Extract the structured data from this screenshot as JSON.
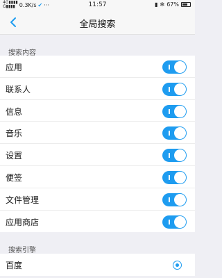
{
  "status_bar": {
    "network": "4G",
    "speed": "0.3K/s",
    "time": "11:57",
    "battery": "67%",
    "more": "···"
  },
  "header": {
    "title": "全局搜索",
    "back_icon": "chevron-left-icon"
  },
  "search_content": {
    "section_title": "搜索内容",
    "items": [
      {
        "label": "应用",
        "enabled": true
      },
      {
        "label": "联系人",
        "enabled": true
      },
      {
        "label": "信息",
        "enabled": true
      },
      {
        "label": "音乐",
        "enabled": true
      },
      {
        "label": "设置",
        "enabled": true
      },
      {
        "label": "便签",
        "enabled": true
      },
      {
        "label": "文件管理",
        "enabled": true
      },
      {
        "label": "应用商店",
        "enabled": true
      }
    ]
  },
  "search_engine": {
    "section_title": "搜索引擎",
    "items": [
      {
        "label": "百度",
        "selected": true
      }
    ]
  },
  "colors": {
    "accent": "#1e9cf0",
    "background": "#efeff4"
  }
}
